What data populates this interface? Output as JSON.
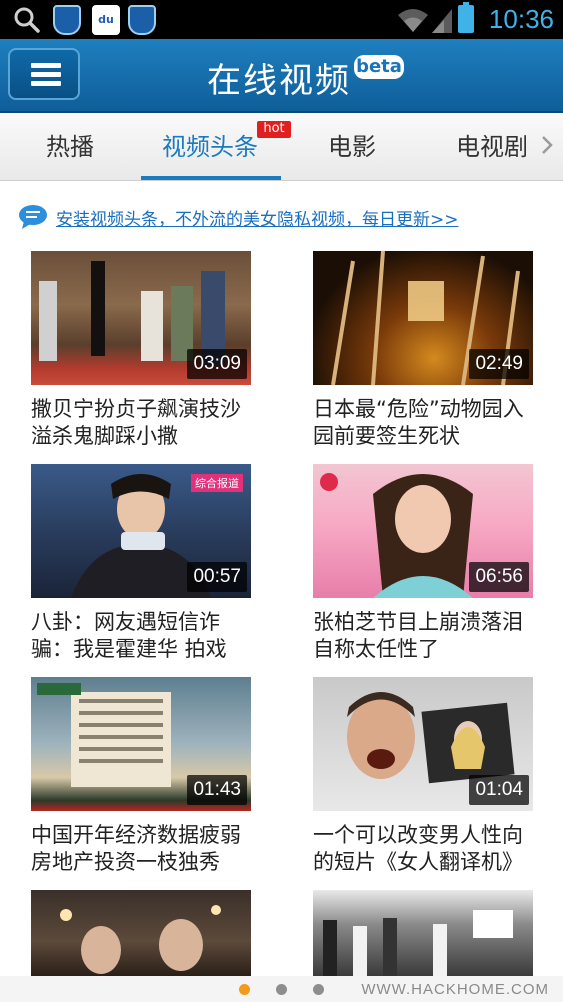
{
  "status_bar": {
    "time": "10:36",
    "icons": [
      "search-icon",
      "shield-app-icon",
      "baidu-app-icon",
      "shield-app-icon",
      "wifi-icon",
      "signal-icon",
      "battery-icon"
    ],
    "baidu_label": "du"
  },
  "header": {
    "title": "在线视频",
    "badge": "beta",
    "menu_icon": "hamburger-menu-icon",
    "background": "#1a73b5"
  },
  "tabs": {
    "items": [
      {
        "label": "热播"
      },
      {
        "label": "视频头条",
        "badge": "hot",
        "active": true
      },
      {
        "label": "电影"
      },
      {
        "label": "电视剧"
      }
    ],
    "active_color": "#1a7bbf"
  },
  "promo": {
    "icon": "chat-bubble-icon",
    "text": "安装视频头条，不外流的美女隐私视频，每日更新>>"
  },
  "videos": [
    {
      "duration": "03:09",
      "title": "撒贝宁扮贞子飙演技沙溢杀鬼脚踩小撒"
    },
    {
      "duration": "02:49",
      "title": "日本最“危险”动物园入园前要签生死状"
    },
    {
      "duration": "00:57",
      "title": "八卦：网友遇短信诈骗：我是霍建华 拍戏",
      "overlay": "综合报道"
    },
    {
      "duration": "06:56",
      "title": "张柏芝节目上崩溃落泪自称太任性了"
    },
    {
      "duration": "01:43",
      "title": "中国开年经济数据疲弱房地产投资一枝独秀"
    },
    {
      "duration": "01:04",
      "title": "一个可以改变男人性向的短片《女人翻译机》"
    },
    {
      "duration": "",
      "title": ""
    },
    {
      "duration": "",
      "title": ""
    }
  ],
  "pager": {
    "pages": 3,
    "active_index": 0,
    "active_color": "#f39a1d"
  },
  "watermark": "WWW.HACKHOME.COM"
}
